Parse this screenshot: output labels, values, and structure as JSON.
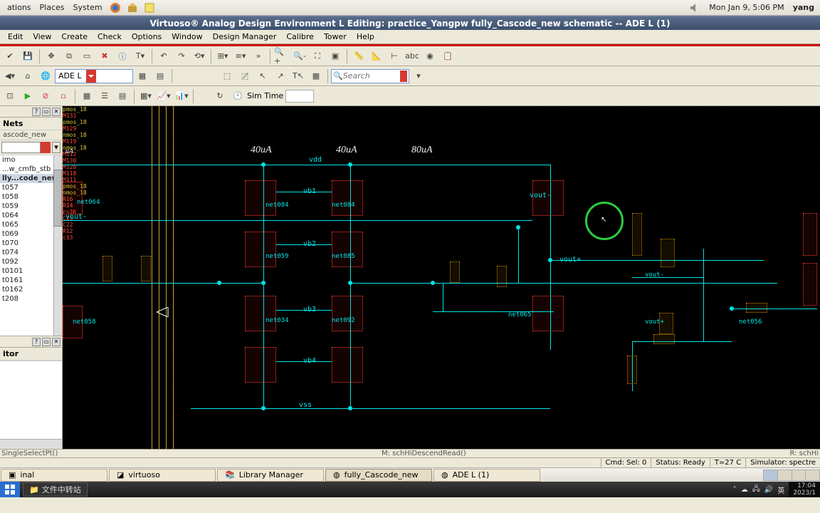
{
  "gnome": {
    "menus": [
      "ations",
      "Places",
      "System"
    ],
    "clock": "Mon Jan  9,  5:06 PM",
    "user": "yang"
  },
  "window": {
    "title": "Virtuoso® Analog Design Environment L Editing: practice_Yangpw fully_Cascode_new schematic -- ADE L (1)"
  },
  "menubar": [
    "Edit",
    "View",
    "Create",
    "Check",
    "Options",
    "Window",
    "Design Manager",
    "Calibre",
    "Tower",
    "Help"
  ],
  "toolbar2": {
    "combo_label": "ADE L"
  },
  "toolbar3": {
    "sim_time": "Sim Time",
    "search_placeholder": "Search"
  },
  "side": {
    "title": "Nets",
    "sub": "ascode_new",
    "items": [
      "imo",
      "...w_cmfb_stb",
      "lly...code_new)",
      "t057",
      "t058",
      "t059",
      "t064",
      "t065",
      "t069",
      "t070",
      "t074",
      "t092",
      "t0101",
      "t0161",
      "t0162",
      "t208"
    ],
    "selected_index": 2,
    "section2": "itor"
  },
  "canvas": {
    "currents": [
      "uA",
      "40uA",
      "40uA",
      "80uA"
    ],
    "rails": {
      "vdd": "vdd",
      "vss": "vss"
    },
    "bias": [
      "vb1",
      "vb2",
      "vb3",
      "vb4"
    ],
    "outs": [
      "vout-",
      "vout+",
      "vout-",
      "vout+"
    ],
    "devtags": [
      "pmos_18",
      "pmos_18",
      "pmos_18",
      "nmos_18",
      "nmos_18",
      "nmos_18",
      "nmos_18"
    ],
    "refs": [
      "M131",
      "M130",
      "M129",
      "M128",
      "M119",
      "M118",
      "M112",
      "M111",
      "R12",
      "R14",
      "R16",
      "C25",
      "C22",
      "c13",
      "r=3K",
      "net064",
      "net084",
      "net085",
      "net059",
      "net034",
      "net065",
      "net092",
      "net058",
      "net056",
      "net085"
    ]
  },
  "status": {
    "left": "SingleSelectPt()",
    "center": "M: schHiDescendRead()",
    "right": "R: schHi",
    "cmd": "Cmd:  Sel: 0",
    "ready": "Status: Ready",
    "temp": "T=27 C",
    "sim": "Simulator: spectre"
  },
  "taskbar": {
    "items": [
      "inal",
      "virtuoso",
      "Library Manager",
      "fully_Cascode_new",
      "ADE L (1)"
    ],
    "active_index": 3
  },
  "wintask": {
    "item": "文件中转站",
    "ime": "英",
    "clock": "17:04",
    "date": "2023/1"
  }
}
